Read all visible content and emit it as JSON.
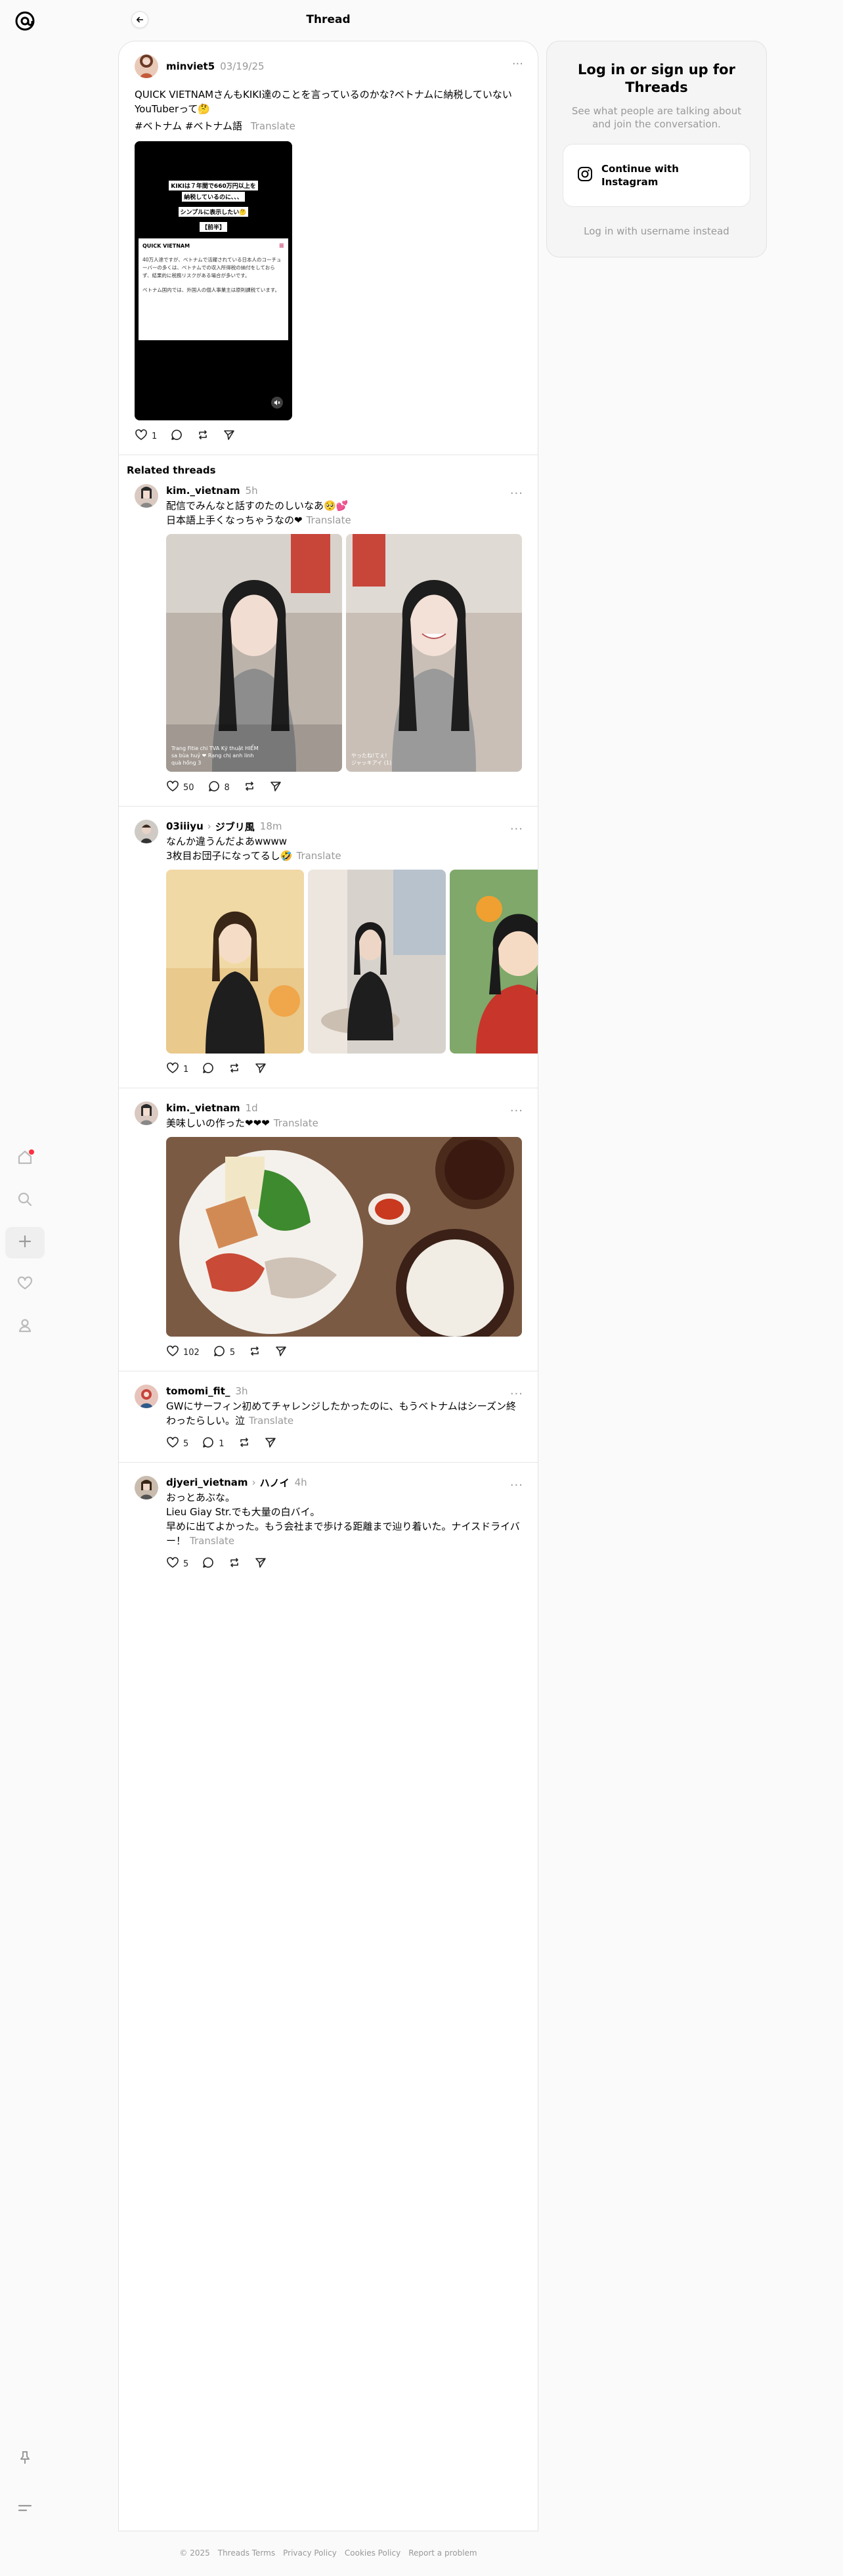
{
  "header": {
    "title": "Thread"
  },
  "main_post": {
    "username": "minviet5",
    "date": "03/19/25",
    "text": "QUICK VIETNAMさんもKIKI達のことを言っているのかな?ベトナムに納税していないYouTuberって🤔",
    "hashtags": "#ベトナム #ベトナム語",
    "translate": "Translate",
    "likes": "1",
    "video": {
      "caption_line1": "KIKIは７年間で660万円以上を",
      "caption_line2": "納税しているのに、、、",
      "caption_line3": "シンプルに表示したい🤔",
      "caption_line4": "【前半】",
      "site_label": "QUICK VIETNAM",
      "body_text": "40万人達ですが、ベトナムで活躍されている日本人のコーチューバーの多くは、ベトナムでの収入所得税の納付をしておらず、結果的に税務リスクがある場合が多いです。",
      "body_text2": "ベトナム国内では、外国人の個人事業主は原則課税ています。"
    }
  },
  "related_heading": "Related threads",
  "related": [
    {
      "username": "kim._vietnam",
      "time": "5h",
      "text": "配信でみんなと話すのたのしいなあ🥺💕\n日本語上手くなっちゃうなの❤",
      "translate": "Translate",
      "likes": "50",
      "replies": "8",
      "overlay_left_1": "Trang Fitie chi TVA  Kỹ thuật HIỂM",
      "overlay_left_2": "sa bùa huỷ  ❤ Rạng chị anh linh",
      "overlay_left_3": "quà hồng 3",
      "overlay_right_1": "やったね!てぇ!",
      "overlay_right_2": "ジャッキアイ  (1)"
    },
    {
      "username": "03iiiyu",
      "topic": "ジブリ風",
      "time": "18m",
      "text": "なんか違うんだよあwwww\n3枚目お団子になってるし🤣",
      "translate": "Translate",
      "likes": "1"
    },
    {
      "username": "kim._vietnam",
      "time": "1d",
      "text": "美味しいの作った❤❤❤",
      "translate": "Translate",
      "likes": "102",
      "replies": "5"
    },
    {
      "username": "tomomi_fit_",
      "time": "3h",
      "text": "GWにサーフィン初めてチャレンジしたかったのに、もうベトナムはシーズン終わったらしい。泣",
      "translate": "Translate",
      "likes": "5",
      "replies": "1"
    },
    {
      "username": "djyeri_vietnam",
      "topic": "ハノイ",
      "time": "4h",
      "text": "おっとあぶな。\nLieu Giay Str.でも大量の白バイ。\n早めに出てよかった。もう会社まで歩ける距離まで辿り着いた。ナイスドライバー！",
      "translate": "Translate",
      "likes": "5"
    }
  ],
  "login": {
    "title": "Log in or sign up for Threads",
    "subtitle": "See what people are talking about and join the conversation.",
    "instagram_button": "Continue with Instagram",
    "alt_login": "Log in with username instead"
  },
  "footer": {
    "copyright": "© 2025",
    "terms": "Threads Terms",
    "privacy": "Privacy Policy",
    "cookies": "Cookies Policy",
    "report": "Report a problem"
  },
  "colors": {
    "accent": "#ff3040",
    "muted": "#999999",
    "background": "#fafafa"
  }
}
